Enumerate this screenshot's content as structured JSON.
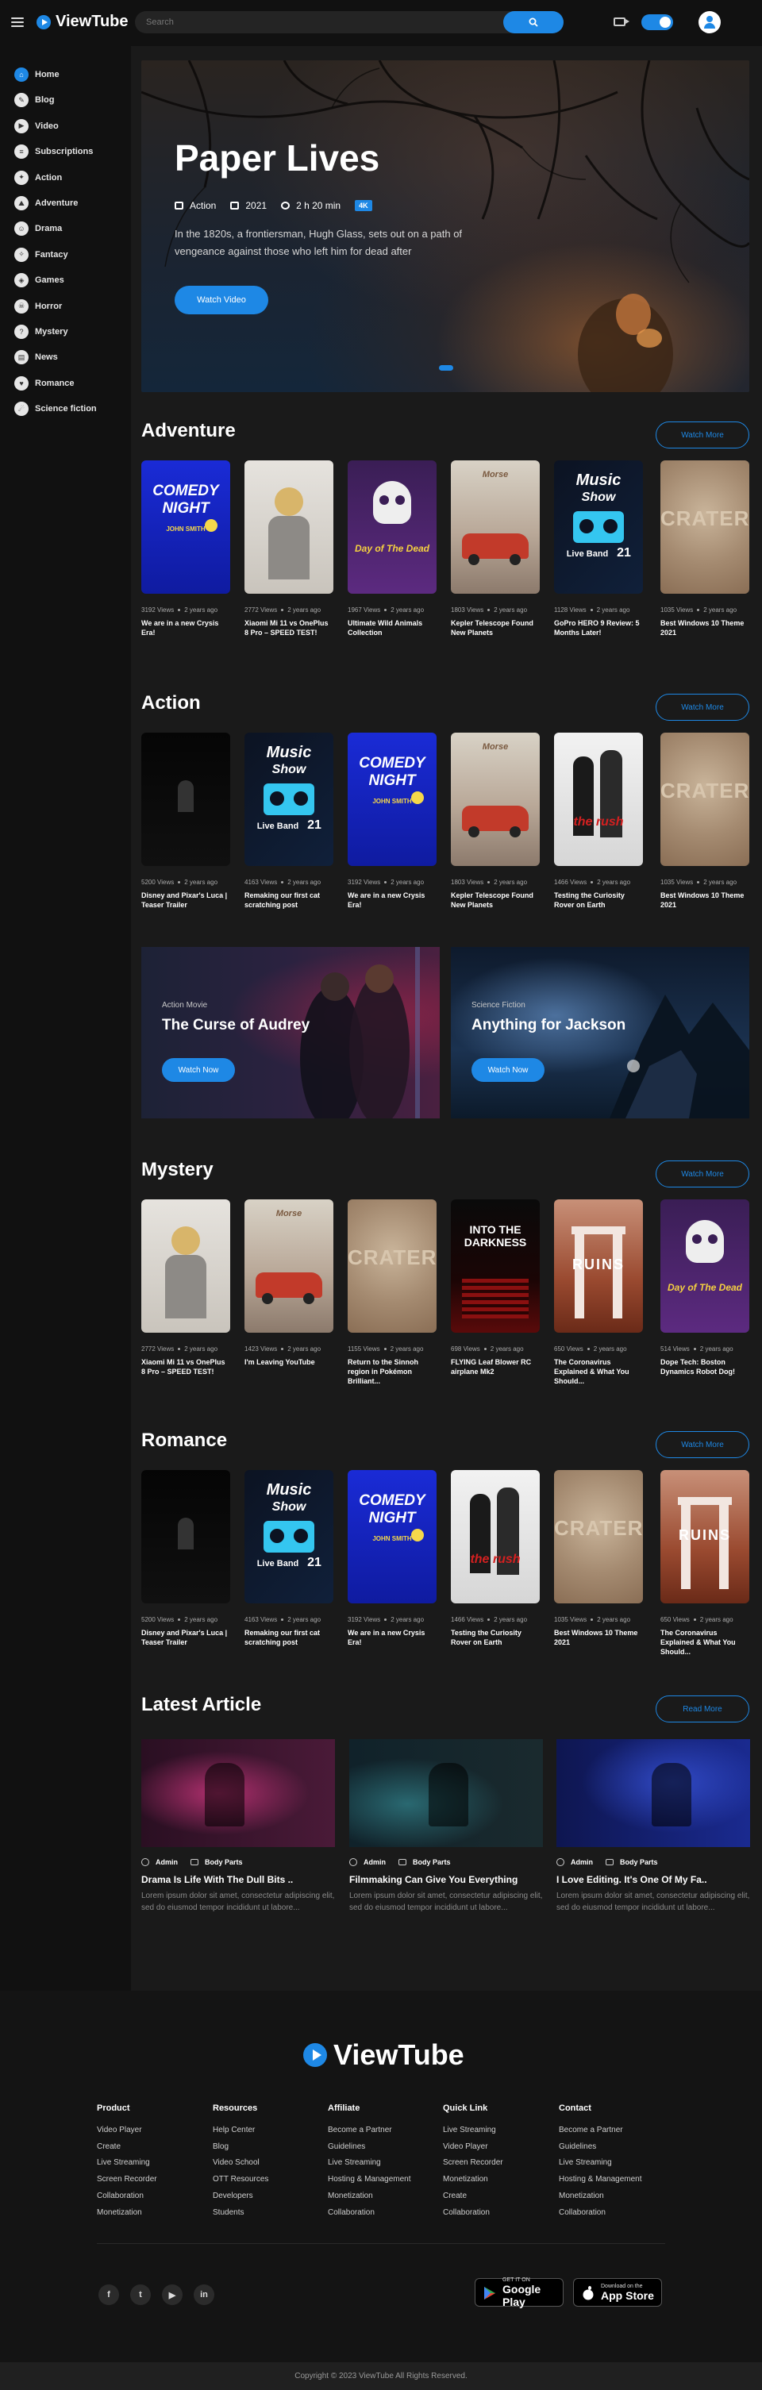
{
  "header": {
    "logo": "ViewTube",
    "search_placeholder": "Search"
  },
  "sidebar": {
    "items": [
      {
        "label": "Home",
        "icon": "home-icon",
        "active": true
      },
      {
        "label": "Blog",
        "icon": "blog-icon",
        "active": false
      },
      {
        "label": "Video",
        "icon": "video-icon",
        "active": false
      },
      {
        "label": "Subscriptions",
        "icon": "subscriptions-icon",
        "active": false
      },
      {
        "label": "Action",
        "icon": "action-icon",
        "active": false
      },
      {
        "label": "Adventure",
        "icon": "adventure-icon",
        "active": false
      },
      {
        "label": "Drama",
        "icon": "drama-icon",
        "active": false
      },
      {
        "label": "Fantacy",
        "icon": "fantasy-icon",
        "active": false
      },
      {
        "label": "Games",
        "icon": "games-icon",
        "active": false
      },
      {
        "label": "Horror",
        "icon": "horror-icon",
        "active": false
      },
      {
        "label": "Mystery",
        "icon": "mystery-icon",
        "active": false
      },
      {
        "label": "News",
        "icon": "news-icon",
        "active": false
      },
      {
        "label": "Romance",
        "icon": "romance-icon",
        "active": false
      },
      {
        "label": "Science fiction",
        "icon": "science-fiction-icon",
        "active": false
      }
    ]
  },
  "hero": {
    "title": "Paper Lives",
    "genre": "Action",
    "year": "2021",
    "duration": "2 h 20 min",
    "badge": "4K",
    "description": "In the 1820s, a frontiersman, Hugh Glass, sets out on a path of vengeance against those who left him for dead after",
    "button": "Watch Video"
  },
  "sections": [
    {
      "title": "Adventure",
      "button": "Watch More",
      "cards": [
        {
          "poster": "comedy",
          "views": "3192 Views",
          "age": "2 years ago",
          "title": "We are in a new Crysis Era!"
        },
        {
          "poster": "astronaut",
          "views": "2772 Views",
          "age": "2 years ago",
          "title": "Xiaomi Mi 11 vs OnePlus 8 Pro – SPEED TEST!"
        },
        {
          "poster": "skull",
          "views": "1967 Views",
          "age": "2 years ago",
          "title": "Ultimate Wild Animals Collection"
        },
        {
          "poster": "car",
          "views": "1803 Views",
          "age": "2 years ago",
          "title": "Kepler Telescope Found New Planets"
        },
        {
          "poster": "music",
          "views": "1128 Views",
          "age": "2 years ago",
          "title": "GoPro HERO 9 Review: 5 Months Later!"
        },
        {
          "poster": "crater",
          "views": "1035 Views",
          "age": "2 years ago",
          "title": "Best Windows 10 Theme 2021"
        }
      ]
    },
    {
      "title": "Action",
      "button": "Watch More",
      "cards": [
        {
          "poster": "dark",
          "views": "5200 Views",
          "age": "2 years ago",
          "title": "Disney and Pixar's Luca | Teaser Trailer"
        },
        {
          "poster": "music",
          "views": "4163 Views",
          "age": "2 years ago",
          "title": "Remaking our first cat scratching post"
        },
        {
          "poster": "comedy",
          "views": "3192 Views",
          "age": "2 years ago",
          "title": "We are in a new Crysis Era!"
        },
        {
          "poster": "car",
          "views": "1803 Views",
          "age": "2 years ago",
          "title": "Kepler Telescope Found New Planets"
        },
        {
          "poster": "rush",
          "views": "1466 Views",
          "age": "2 years ago",
          "title": "Testing the Curiosity Rover on Earth"
        },
        {
          "poster": "crater",
          "views": "1035 Views",
          "age": "2 years ago",
          "title": "Best Windows 10 Theme 2021"
        }
      ]
    },
    {
      "title": "Mystery",
      "button": "Watch More",
      "cards": [
        {
          "poster": "astronaut",
          "views": "2772 Views",
          "age": "2 years ago",
          "title": "Xiaomi Mi 11 vs OnePlus 8 Pro – SPEED TEST!"
        },
        {
          "poster": "car",
          "views": "1423 Views",
          "age": "2 years ago",
          "title": "I'm Leaving YouTube"
        },
        {
          "poster": "crater",
          "views": "1155 Views",
          "age": "2 years ago",
          "title": "Return to the Sinnoh region in Pokémon Brilliant..."
        },
        {
          "poster": "darkness",
          "views": "698 Views",
          "age": "2 years ago",
          "title": "FLYING Leaf Blower RC airplane Mk2"
        },
        {
          "poster": "ruins",
          "views": "650 Views",
          "age": "2 years ago",
          "title": "The Coronavirus Explained & What You Should..."
        },
        {
          "poster": "skull",
          "views": "514 Views",
          "age": "2 years ago",
          "title": "Dope Tech: Boston Dynamics Robot Dog!"
        }
      ]
    },
    {
      "title": "Romance",
      "button": "Watch More",
      "cards": [
        {
          "poster": "dark",
          "views": "5200 Views",
          "age": "2 years ago",
          "title": "Disney and Pixar's Luca | Teaser Trailer"
        },
        {
          "poster": "music",
          "views": "4163 Views",
          "age": "2 years ago",
          "title": "Remaking our first cat scratching post"
        },
        {
          "poster": "comedy",
          "views": "3192 Views",
          "age": "2 years ago",
          "title": "We are in a new Crysis Era!"
        },
        {
          "poster": "rush",
          "views": "1466 Views",
          "age": "2 years ago",
          "title": "Testing the Curiosity Rover on Earth"
        },
        {
          "poster": "crater",
          "views": "1035 Views",
          "age": "2 years ago",
          "title": "Best Windows 10 Theme 2021"
        },
        {
          "poster": "ruins",
          "views": "650 Views",
          "age": "2 years ago",
          "title": "The Coronavirus Explained & What You Should..."
        }
      ]
    }
  ],
  "posters": {
    "comedy": {
      "line1": "COMEDY",
      "line2": "NIGHT",
      "sub": "JOHN SMITH"
    },
    "music": {
      "line1": "Music",
      "line2": "Show",
      "sub": "Live Band",
      "date": "21"
    },
    "skull": {
      "line1": "Day of The Dead"
    },
    "crater": {
      "line1": "CRATER"
    },
    "darkness": {
      "line1": "INTO THE",
      "line2": "DARKNESS"
    },
    "ruins": {
      "line1": "RUINS"
    },
    "rush": {
      "line1": "the rush"
    },
    "car": {
      "line1": "Morse"
    },
    "astronaut": {},
    "dark": {}
  },
  "banners": [
    {
      "sub": "Action Movie",
      "title": "The Curse of Audrey",
      "button": "Watch Now"
    },
    {
      "sub": "Science Fiction",
      "title": "Anything for Jackson",
      "button": "Watch Now"
    }
  ],
  "articles": {
    "title": "Latest Article",
    "button": "Read More",
    "items": [
      {
        "author": "Admin",
        "category": "Body Parts",
        "title": "Drama Is Life With The Dull Bits ..",
        "text": "Lorem ipsum dolor sit amet, consectetur adipiscing elit, sed do eiusmod tempor incididunt ut labore..."
      },
      {
        "author": "Admin",
        "category": "Body Parts",
        "title": "Filmmaking Can Give You Everything",
        "text": "Lorem ipsum dolor sit amet, consectetur adipiscing elit, sed do eiusmod tempor incididunt ut labore..."
      },
      {
        "author": "Admin",
        "category": "Body Parts",
        "title": "I Love Editing. It's One Of My Fa..",
        "text": "Lorem ipsum dolor sit amet, consectetur adipiscing elit, sed do eiusmod tempor incididunt ut labore..."
      }
    ]
  },
  "footer": {
    "logo": "ViewTube",
    "columns": [
      {
        "title": "Product",
        "links": [
          "Video Player",
          "Create",
          "Live Streaming",
          "Screen Recorder",
          "Collaboration",
          "Monetization"
        ]
      },
      {
        "title": "Resources",
        "links": [
          "Help Center",
          "Blog",
          "Video School",
          "OTT Resources",
          "Developers",
          "Students"
        ]
      },
      {
        "title": "Affiliate",
        "links": [
          "Become a Partner",
          "Guidelines",
          "Live Streaming",
          "Hosting & Management",
          "Monetization",
          "Collaboration"
        ]
      },
      {
        "title": "Quick Link",
        "links": [
          "Live Streaming",
          "Video Player",
          "Screen Recorder",
          "Monetization",
          "Create",
          "Collaboration"
        ]
      },
      {
        "title": "Contact",
        "links": [
          "Become a Partner",
          "Guidelines",
          "Live Streaming",
          "Hosting & Management",
          "Monetization",
          "Collaboration"
        ]
      }
    ],
    "social": [
      "facebook-icon",
      "twitter-icon",
      "youtube-icon",
      "linkedin-icon"
    ],
    "stores": [
      {
        "small": "GET IT ON",
        "big": "Google Play"
      },
      {
        "small": "Download on the",
        "big": "App Store"
      }
    ],
    "copyright": "Copyright © 2023 ViewTube All Rights Reserved."
  },
  "colors": {
    "accent": "#1e88e5",
    "background": "#1a1a1a",
    "sidebar": "#111111"
  }
}
